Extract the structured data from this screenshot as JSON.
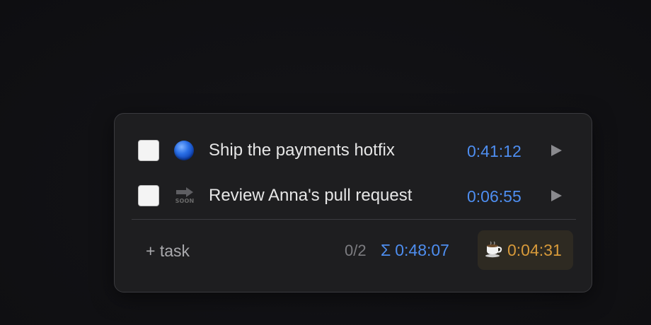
{
  "tasks": [
    {
      "title": "Ship the payments hotfix",
      "icon": "blue-circle-icon",
      "elapsed": "0:41:12",
      "done": false
    },
    {
      "title": "Review Anna's pull request",
      "icon": "soon-arrow-icon",
      "icon_text": "SOON",
      "elapsed": "0:06:55",
      "done": false
    }
  ],
  "footer": {
    "add_task_label": "+ task",
    "progress": "0/2",
    "total_symbol": "Σ",
    "total_time": "0:48:07",
    "break_time": "0:04:31"
  },
  "colors": {
    "accent_blue": "#4e8ef0",
    "break_amber": "#d89a3a",
    "panel_bg": "#1e1e20"
  }
}
